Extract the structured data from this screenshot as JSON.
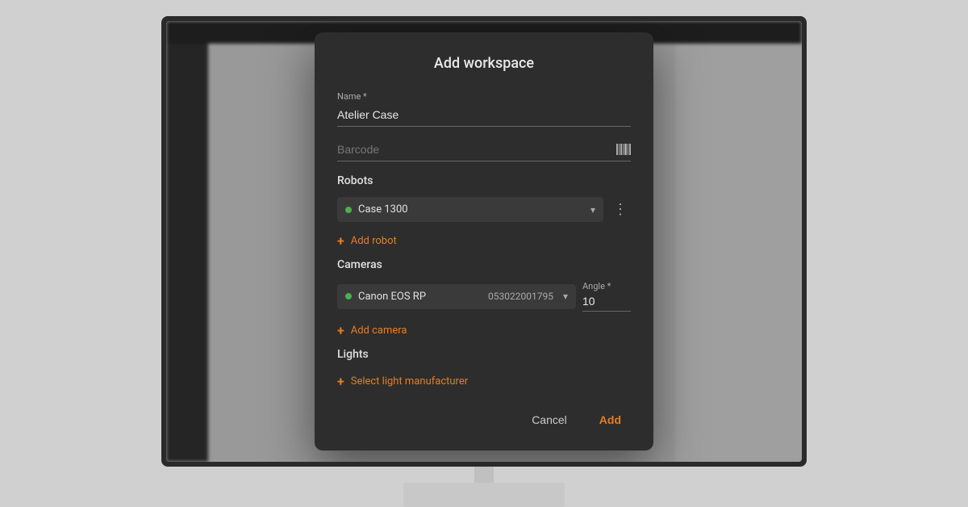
{
  "background": {
    "color": "#d4d4d4"
  },
  "modal": {
    "title": "Add workspace",
    "name_label": "Name *",
    "name_value": "Atelier Case",
    "barcode_placeholder": "Barcode",
    "robots_section": "Robots",
    "robot_name": "Case 1300",
    "robot_status": "active",
    "add_robot_label": "Add robot",
    "cameras_section": "Cameras",
    "camera_name": "Canon EOS RP",
    "camera_barcode": "053022001795",
    "camera_status": "active",
    "angle_label": "Angle *",
    "angle_value": "10",
    "add_camera_label": "Add camera",
    "lights_section": "Lights",
    "select_light_label": "Select light manufacturer",
    "cancel_label": "Cancel",
    "add_label": "Add"
  }
}
